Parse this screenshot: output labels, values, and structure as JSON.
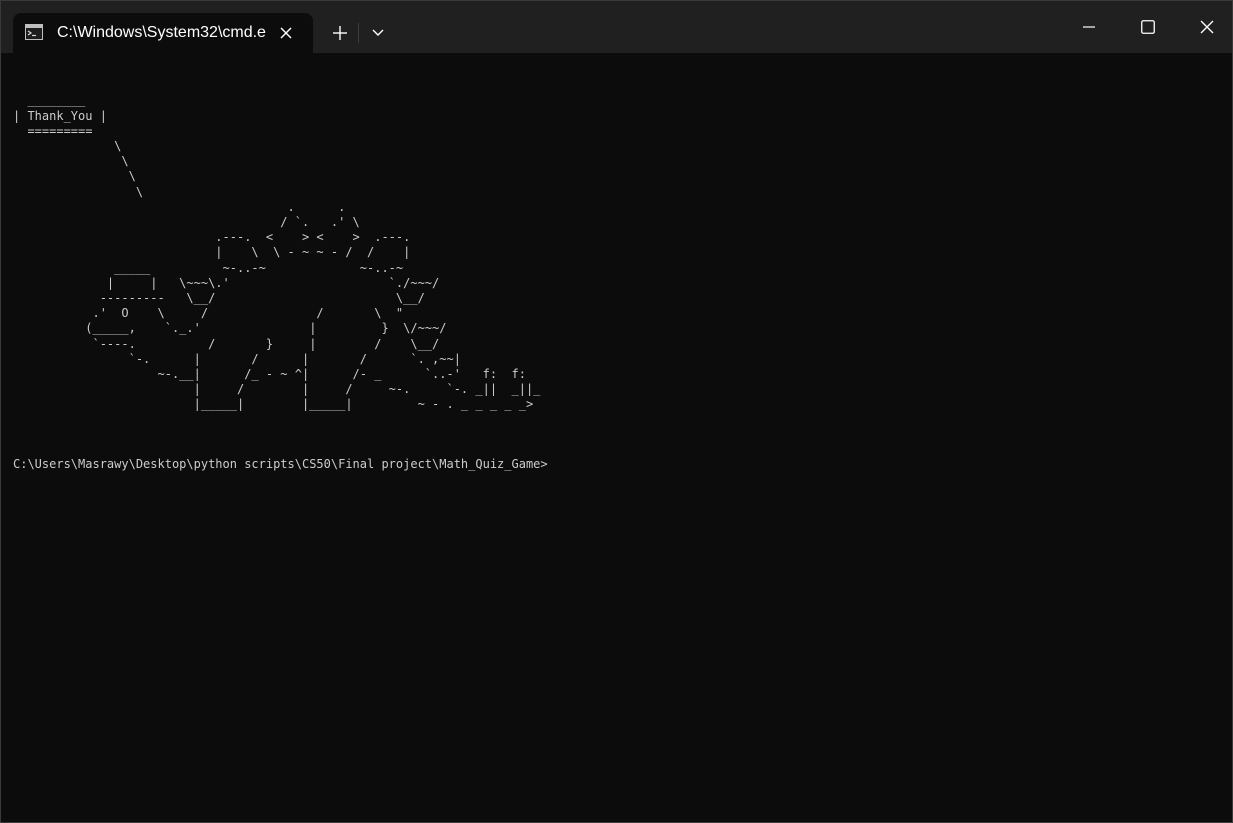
{
  "window": {
    "tab_title": "C:\\Windows\\System32\\cmd.e",
    "tab_icon": "cmd-icon",
    "buttons": {
      "new_tab": "plus-icon",
      "dropdown": "chevron-down-icon",
      "minimize": "minimize-icon",
      "maximize": "maximize-icon",
      "close": "close-icon"
    },
    "colors": {
      "titlebar": "#202020",
      "tab_active": "#0c0c0c",
      "console_bg": "#0c0c0c",
      "console_text": "#cccccc"
    }
  },
  "console": {
    "art": "  ________\n| Thank_You |\n  =========\n              \\\n               \\\n                \\\n                 \\\n                                      .      .\n                                     / `.   .' \\\n                            .---.  <    > <    >  .---.\n                            |    \\  \\ - ~ ~ - /  /    |\n              _____          ~-..-~             ~-..-~\n             |     |   \\~~~\\.'                      `./~~~/\n            ---------   \\__/                         \\__/\n           .'  O    \\     /               /       \\  \"\n          (_____,    `._.'               |         }  \\/~~~/\n           `----.          /       }     |        /    \\__/\n                `-.      |       /      |       /      `. ,~~|\n                    ~-.__|      /_ - ~ ^|      /- _      `..-'   f:  f:\n                         |     /        |     /     ~-.     `-. _||  _||_\n                         |_____|        |_____|         ~ - . _ _ _ _ _>",
    "prompt": "C:\\Users\\Masrawy\\Desktop\\python scripts\\CS50\\Final project\\Math_Quiz_Game>"
  }
}
